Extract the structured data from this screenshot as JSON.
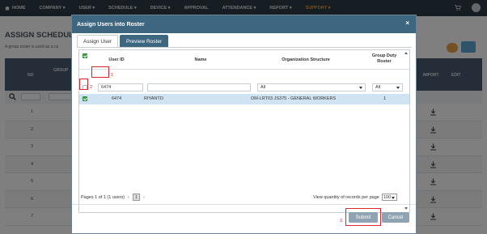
{
  "nav": {
    "items": [
      "HOME",
      "COMPANY",
      "USER",
      "SCHEDULE",
      "DEVICE",
      "APPROVAL",
      "ATTENDANCE",
      "REPORT",
      "SUPPORT"
    ],
    "active_color": "#e7a23b",
    "icons": [
      "home-icon",
      "cart-icon",
      "avatar"
    ]
  },
  "background": {
    "title": "ASSIGN SCHEDULES",
    "description": "A group roster is used as a ca",
    "headers": [
      "NO",
      "GROUP",
      "IMPORT",
      "EDIT"
    ],
    "row_numbers": [
      "1",
      "2",
      "3",
      "4",
      "5",
      "6",
      "7"
    ]
  },
  "modal": {
    "title": "Assign Users into Roster",
    "close": "×",
    "tabs": [
      "Assign User",
      "Preview Roster"
    ],
    "columns": {
      "user_id": "User ID",
      "name": "Name",
      "org": "Organization Structure",
      "group_duty": "Group Duty Roster"
    },
    "filters": {
      "user_id": "6474",
      "name": "",
      "org": "All",
      "group_duty": "All"
    },
    "rows": [
      {
        "user_id": "6474",
        "name": "RIYANTO",
        "org": "OM-LRT03 JS375 - GENERAL WORKERS",
        "group_duty": "1",
        "checked": true
      }
    ],
    "annotations": [
      "1",
      "2",
      "3"
    ],
    "pager": {
      "text": "Pages 1 of 1 (1 users)",
      "prev": "‹",
      "current": "1",
      "next": "›"
    },
    "quantity": {
      "label": "View quantity of records per page",
      "value": "100"
    },
    "buttons": {
      "submit": "Submit",
      "cancel": "Cancel"
    },
    "colors": {
      "header": "#3d6680",
      "selected_row": "#cfe3f2",
      "check": "#3ea64a",
      "highlight": "#d9262c"
    }
  }
}
